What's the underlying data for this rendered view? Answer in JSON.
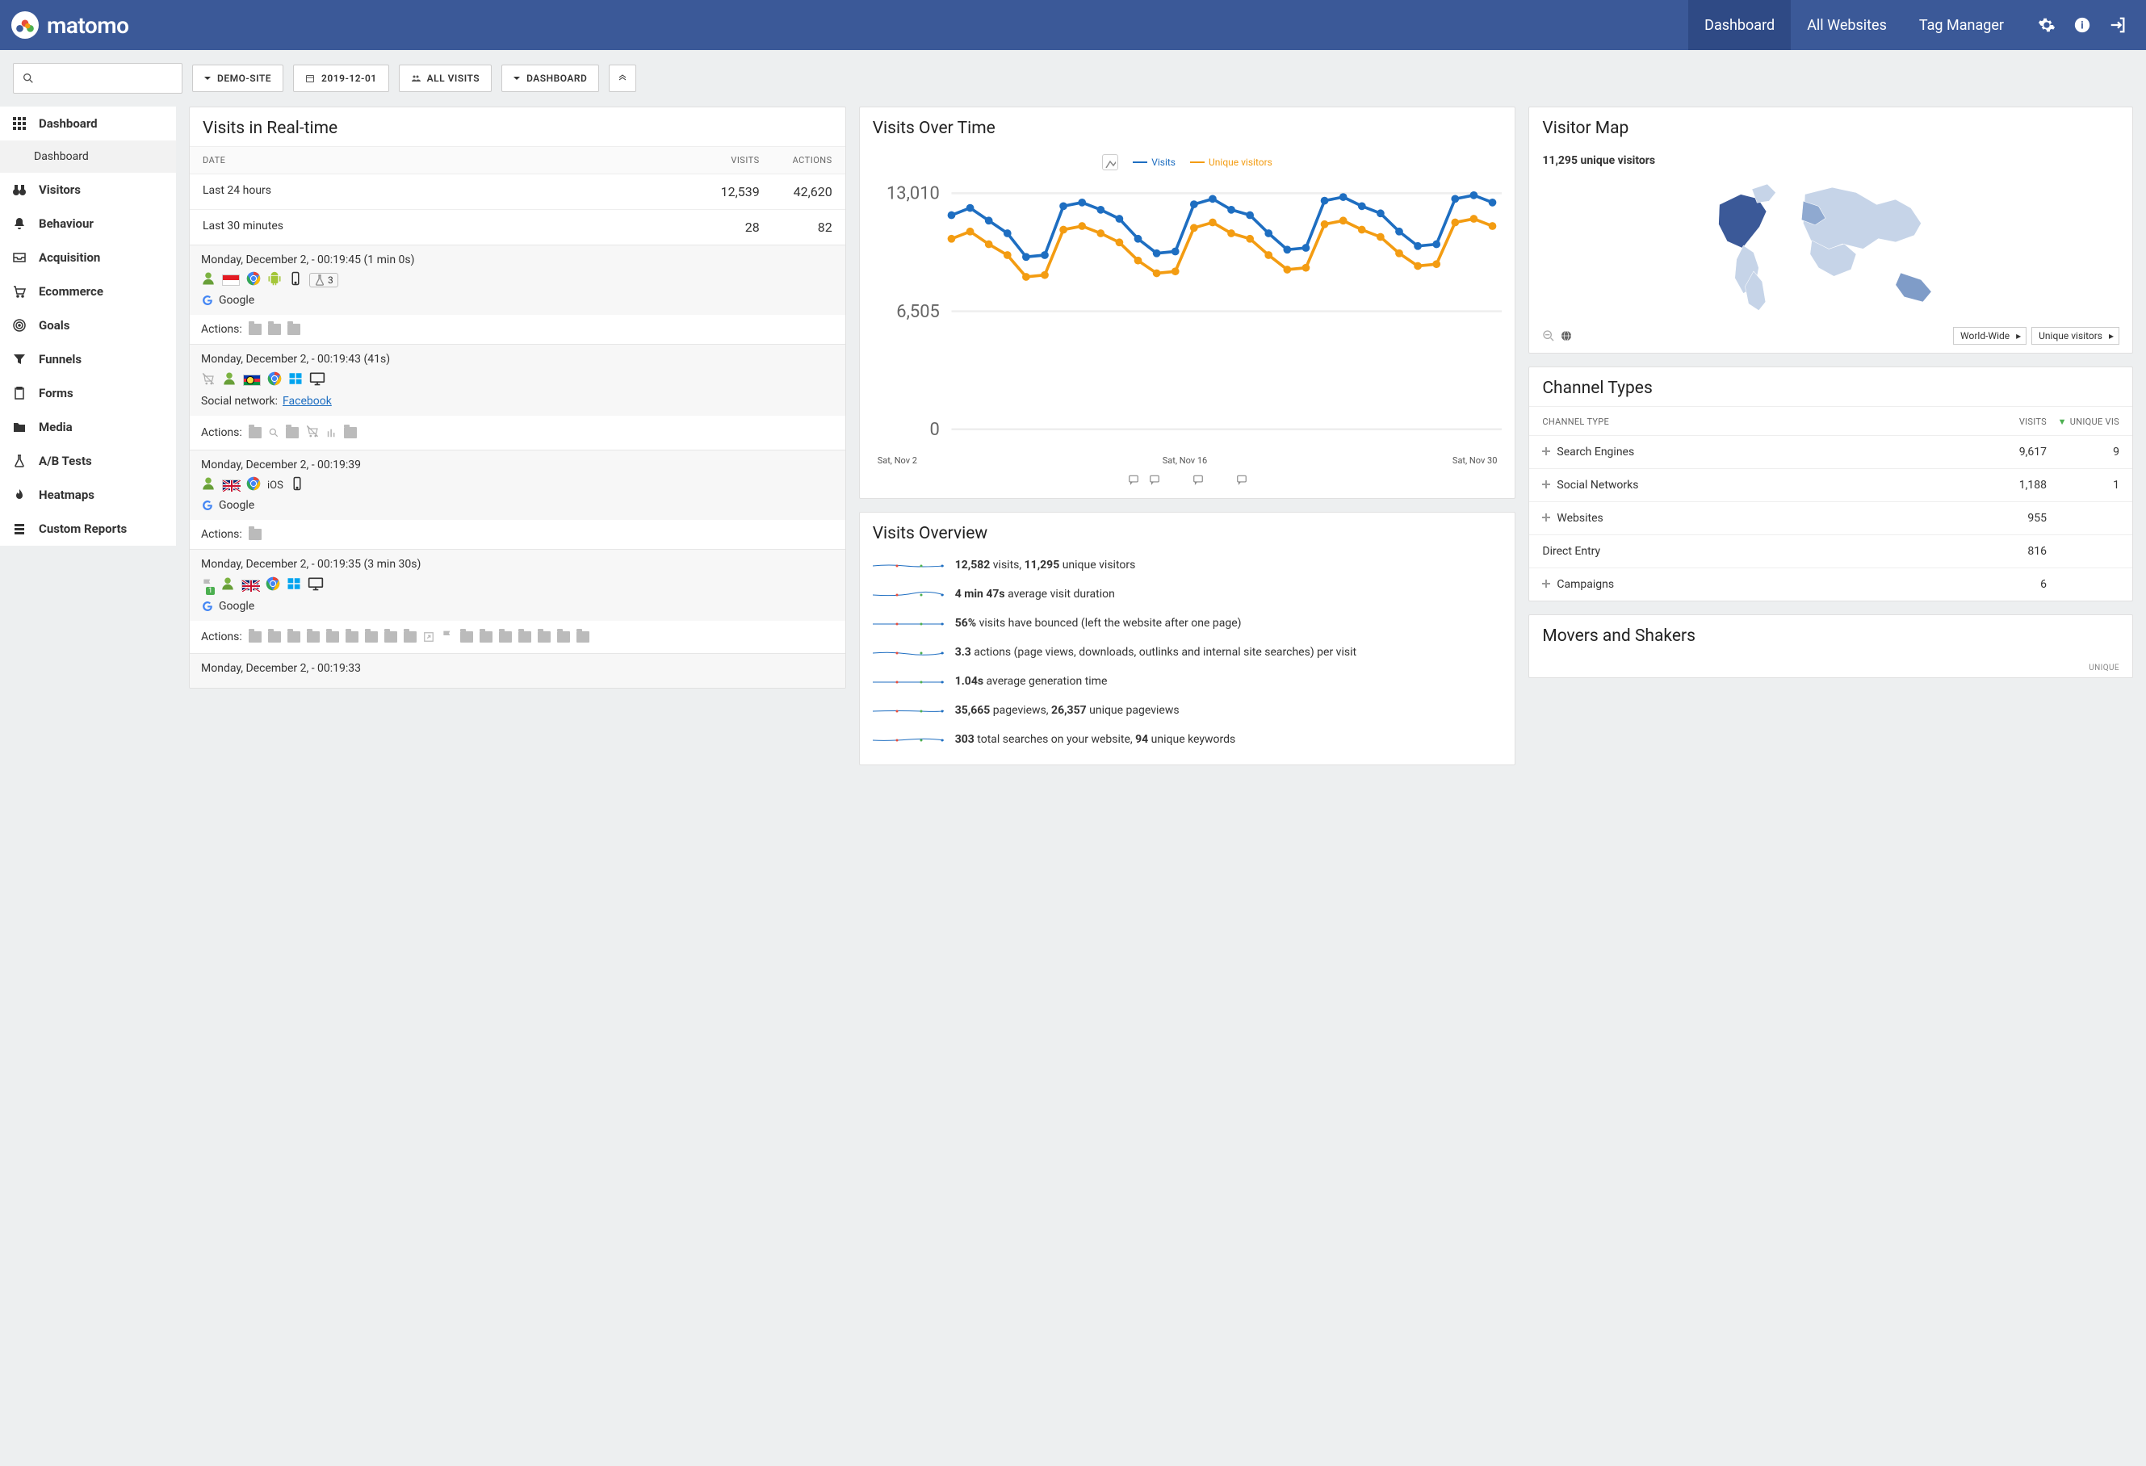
{
  "brand": "matomo",
  "topnav": {
    "items": [
      "Dashboard",
      "All Websites",
      "Tag Manager"
    ],
    "active": 0
  },
  "toolbar": {
    "site": "DEMO-SITE",
    "date": "2019-12-01",
    "segment": "ALL VISITS",
    "dashboard": "DASHBOARD"
  },
  "sidebar": [
    {
      "label": "Dashboard",
      "icon": "grid",
      "bold": true
    },
    {
      "label": "Dashboard",
      "icon": "",
      "sub": true
    },
    {
      "label": "Visitors",
      "icon": "binoculars",
      "bold": true
    },
    {
      "label": "Behaviour",
      "icon": "bell",
      "bold": true
    },
    {
      "label": "Acquisition",
      "icon": "inbox",
      "bold": true
    },
    {
      "label": "Ecommerce",
      "icon": "cart",
      "bold": true
    },
    {
      "label": "Goals",
      "icon": "target",
      "bold": true
    },
    {
      "label": "Funnels",
      "icon": "funnel",
      "bold": true
    },
    {
      "label": "Forms",
      "icon": "clipboard",
      "bold": true
    },
    {
      "label": "Media",
      "icon": "folder",
      "bold": true
    },
    {
      "label": "A/B Tests",
      "icon": "flask",
      "bold": true
    },
    {
      "label": "Heatmaps",
      "icon": "flame",
      "bold": true
    },
    {
      "label": "Custom Reports",
      "icon": "stack",
      "bold": true
    }
  ],
  "realtime": {
    "title": "Visits in Real-time",
    "head": [
      "DATE",
      "VISITS",
      "ACTIONS"
    ],
    "summary": [
      {
        "label": "Last 24 hours",
        "visits": "12,539",
        "actions": "42,620"
      },
      {
        "label": "Last 30 minutes",
        "visits": "28",
        "actions": "82"
      }
    ],
    "visits": [
      {
        "time": "Monday, December 2, - 00:19:45 (1 min 0s)",
        "ref_label": "Google",
        "ref_type": "google",
        "actions_label": "Actions:",
        "action_count": 3,
        "badge": "3"
      },
      {
        "time": "Monday, December 2, - 00:19:43 (41s)",
        "ref_prefix": "Social network:",
        "ref_label": "Facebook",
        "ref_type": "link",
        "actions_label": "Actions:",
        "action_count": 5
      },
      {
        "time": "Monday, December 2, - 00:19:39",
        "ref_label": "Google",
        "ref_type": "google",
        "os": "iOS",
        "actions_label": "Actions:",
        "action_count": 1
      },
      {
        "time": "Monday, December 2, - 00:19:35 (3 min 30s)",
        "ref_label": "Google",
        "ref_type": "google",
        "actions_label": "Actions:",
        "action_count": 18
      },
      {
        "time": "Monday, December 2, - 00:19:33"
      }
    ]
  },
  "chart_data": {
    "type": "line",
    "title": "Visits Over Time",
    "legend": [
      "Visits",
      "Unique visitors"
    ],
    "ylim": [
      0,
      13010
    ],
    "yticks": [
      0,
      6505,
      13010
    ],
    "x_labels": [
      "Sat, Nov 2",
      "Sat, Nov 16",
      "Sat, Nov 30"
    ],
    "series": [
      {
        "name": "Visits",
        "color": "#1e6ec1",
        "values": [
          11800,
          12200,
          11500,
          10800,
          9500,
          9600,
          12300,
          12500,
          12100,
          11600,
          10500,
          9700,
          9800,
          12400,
          12700,
          12100,
          11800,
          10800,
          9900,
          10000,
          12600,
          12800,
          12300,
          11900,
          10900,
          10100,
          10200,
          12700,
          12900,
          12500
        ]
      },
      {
        "name": "Unique visitors",
        "color": "#f39c12",
        "values": [
          10500,
          10900,
          10200,
          9600,
          8400,
          8500,
          11000,
          11200,
          10800,
          10300,
          9300,
          8600,
          8700,
          11100,
          11400,
          10800,
          10500,
          9600,
          8800,
          8900,
          11300,
          11500,
          11000,
          10600,
          9700,
          9000,
          9100,
          11400,
          11600,
          11200
        ]
      }
    ]
  },
  "overview": {
    "title": "Visits Overview",
    "rows": [
      {
        "html": "<b>12,582</b> visits, <b>11,295</b> unique visitors"
      },
      {
        "html": "<b>4 min 47s</b> average visit duration"
      },
      {
        "html": "<b>56%</b> visits have bounced (left the website after one page)"
      },
      {
        "html": "<b>3.3</b> actions (page views, downloads, outlinks and internal site searches) per visit"
      },
      {
        "html": "<b>1.04s</b> average generation time"
      },
      {
        "html": "<b>35,665</b> pageviews, <b>26,357</b> unique pageviews"
      },
      {
        "html": "<b>303</b> total searches on your website, <b>94</b> unique keywords"
      }
    ]
  },
  "map": {
    "title": "Visitor Map",
    "headline": "11,295 unique visitors",
    "region_sel": "World-Wide",
    "metric_sel": "Unique visitors"
  },
  "channels": {
    "title": "Channel Types",
    "head": [
      "CHANNEL TYPE",
      "VISITS",
      "UNIQUE VIS"
    ],
    "rows": [
      {
        "label": "Search Engines",
        "visits": "9,617",
        "uv": "9",
        "expand": true
      },
      {
        "label": "Social Networks",
        "visits": "1,188",
        "uv": "1",
        "expand": true
      },
      {
        "label": "Websites",
        "visits": "955",
        "uv": "",
        "expand": true
      },
      {
        "label": "Direct Entry",
        "visits": "816",
        "uv": "",
        "expand": false
      },
      {
        "label": "Campaigns",
        "visits": "6",
        "uv": "",
        "expand": true
      }
    ]
  },
  "movers": {
    "title": "Movers and Shakers",
    "col": "UNIQUE"
  }
}
